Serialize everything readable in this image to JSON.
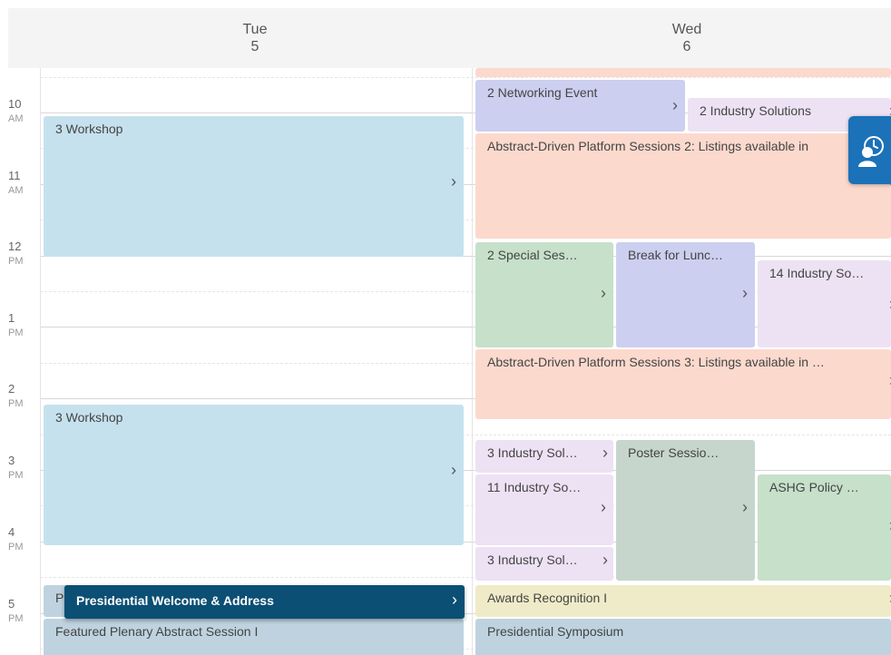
{
  "days": [
    {
      "name": "Tue",
      "date": "5"
    },
    {
      "name": "Wed",
      "date": "6"
    }
  ],
  "time_labels": [
    {
      "hour": "10",
      "ampm": "AM"
    },
    {
      "hour": "11",
      "ampm": "AM"
    },
    {
      "hour": "12",
      "ampm": "PM"
    },
    {
      "hour": "1",
      "ampm": "PM"
    },
    {
      "hour": "2",
      "ampm": "PM"
    },
    {
      "hour": "3",
      "ampm": "PM"
    },
    {
      "hour": "4",
      "ampm": "PM"
    },
    {
      "hour": "5",
      "ampm": "PM"
    }
  ],
  "events": {
    "tue_workshop_1": "3 Workshop",
    "tue_workshop_2": "3 Workshop",
    "tue_p_stub": "P",
    "tue_presidential_welcome": "Presidential Welcome & Address",
    "tue_featured_plenary": "Featured Plenary Abstract Session I",
    "wed_networking": "2 Networking Event",
    "wed_industry_solutions": "2 Industry Solutions",
    "wed_platform_2": "Abstract-Driven Platform Sessions 2: Listings available in",
    "wed_special_ses": "2 Special Ses…",
    "wed_break_lunch": "Break for Lunc…",
    "wed_industry_so_14": "14 Industry So…",
    "wed_platform_3": "Abstract-Driven Platform Sessions 3: Listings available in …",
    "wed_industry_sol_3a": "3 Industry Sol…",
    "wed_poster_session": "Poster Sessio…",
    "wed_industry_so_11": "11 Industry So…",
    "wed_ashg_policy": "ASHG Policy …",
    "wed_industry_sol_3b": "3 Industry Sol…",
    "wed_awards": "Awards Recognition I",
    "wed_presidential_symposium": "Presidential Symposium"
  },
  "chevron": "›",
  "colors": {
    "workshop": "#c6e1ee",
    "platform": "#fcd9cd",
    "networking": "#cccfef",
    "industry": "#ece2f3",
    "special": "#c6e0ca",
    "poster": "#c6d6cc",
    "awards": "#efebc8",
    "plenary": "#bed3df",
    "selected": "#0b4f74",
    "float_button": "#1b72b8"
  }
}
